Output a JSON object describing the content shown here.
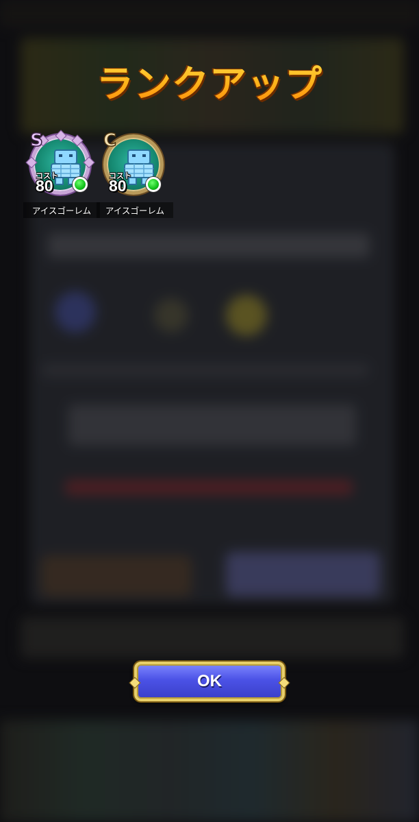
{
  "title": "ランクアップ",
  "monsters": [
    {
      "rank": "S",
      "cost_label": "コスト",
      "cost": "80",
      "name": "アイスゴーレム",
      "rank_color": "#c9a6d8"
    },
    {
      "rank": "C",
      "cost_label": "コスト",
      "cost": "80",
      "name": "アイスゴーレム",
      "rank_color": "#b99a5a"
    }
  ],
  "ok_button": {
    "label": "OK"
  },
  "colors": {
    "title": "#ffb21a",
    "button": "#4b52e6",
    "button_border": "#e8cf6a",
    "status_dot": "#12c21a"
  }
}
